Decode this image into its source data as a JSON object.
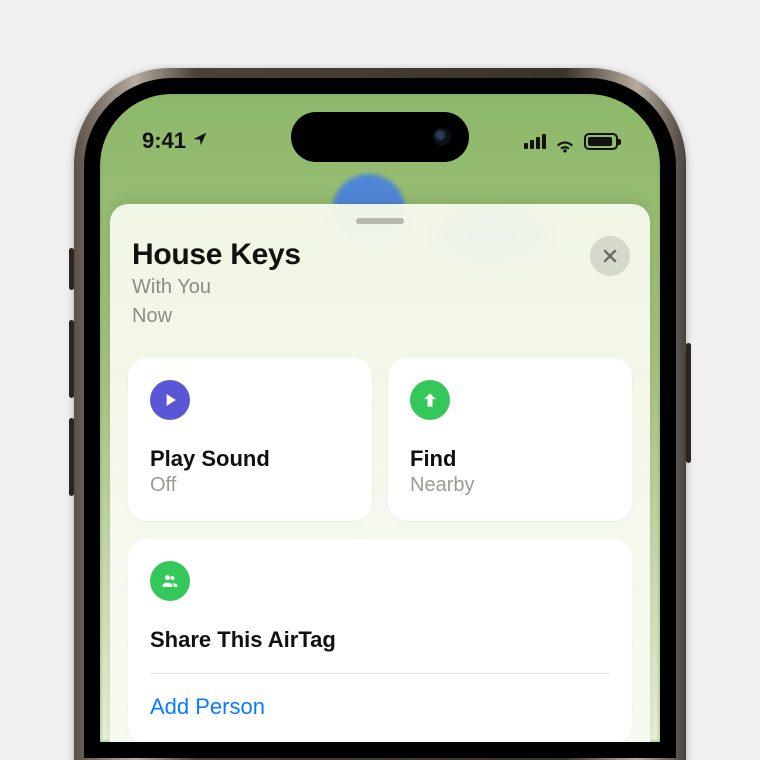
{
  "status": {
    "time": "9:41"
  },
  "sheet": {
    "title": "House Keys",
    "location": "With You",
    "time": "Now"
  },
  "actions": {
    "play_sound": {
      "title": "Play Sound",
      "status": "Off"
    },
    "find": {
      "title": "Find",
      "status": "Nearby"
    }
  },
  "share": {
    "title": "Share This AirTag",
    "add_person": "Add Person"
  }
}
